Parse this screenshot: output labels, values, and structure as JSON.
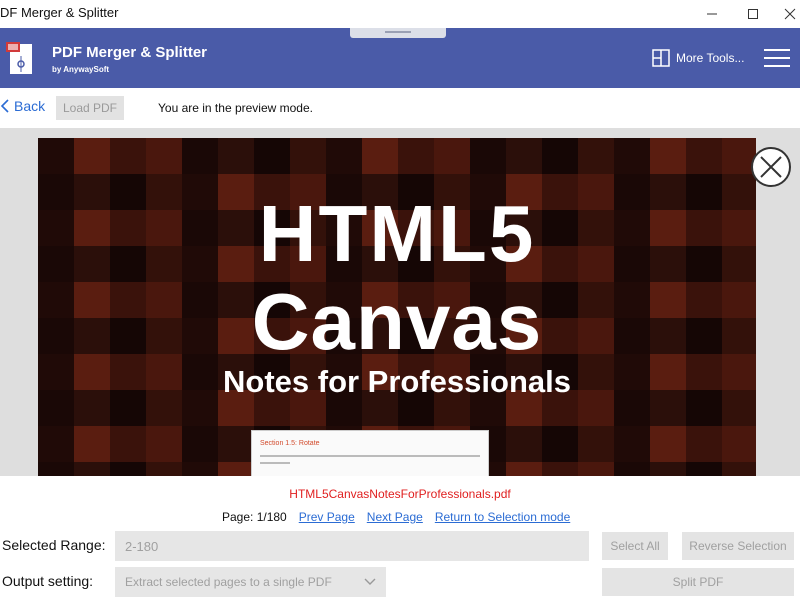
{
  "window": {
    "title": "DF Merger & Splitter"
  },
  "app": {
    "name": "PDF Merger & Splitter",
    "subtitle": "by AnywaySoft",
    "more_tools": "More Tools...",
    "accent": "#4a5ba8"
  },
  "toolbar": {
    "back": "Back",
    "load_pdf": "Load PDF",
    "mode_text": "You are in the preview mode."
  },
  "preview": {
    "title_line1": "HTML5",
    "title_line2": "Canvas",
    "title_line3": "Notes for Professionals",
    "inner_heading": "Section 1.5: Rotate"
  },
  "file": {
    "name": "HTML5CanvasNotesForProfessionals.pdf",
    "name_color": "#e02020"
  },
  "pager": {
    "page": "Page: 1/180",
    "prev": "Prev Page",
    "next": "Next Page",
    "return": "Return to Selection mode"
  },
  "range": {
    "label": "Selected Range:",
    "value": "2-180",
    "select_all": "Select All",
    "reverse": "Reverse Selection"
  },
  "output": {
    "label": "Output setting:",
    "selected": "Extract selected pages to a single PDF",
    "split": "Split PDF"
  },
  "icons": {
    "app_logo": "pdf-document-icon",
    "more_tools": "grid-tools-icon",
    "menu": "hamburger-menu-icon",
    "back": "chevron-left-icon",
    "close": "close-icon",
    "dropdown": "chevron-down-icon"
  }
}
